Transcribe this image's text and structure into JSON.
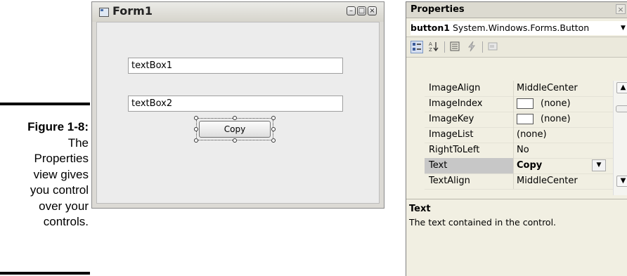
{
  "figure": {
    "number": "Figure 1-8:",
    "lines": [
      "The",
      "Properties",
      "view gives",
      "you control",
      "over your",
      "controls."
    ]
  },
  "form": {
    "title": "Form1",
    "textbox1": "textBox1",
    "textbox2": "textBox2",
    "button_label": "Copy"
  },
  "properties": {
    "title": "Properties",
    "close_glyph": "×",
    "object_name": "button1",
    "object_type": "System.Windows.Forms.Button",
    "toolbar_icons": [
      "categorized-icon",
      "alphabetical-icon",
      "properties-icon",
      "events-icon",
      "property-pages-icon"
    ],
    "rows": [
      {
        "name": "ImageAlign",
        "value": "MiddleCenter"
      },
      {
        "name": "ImageIndex",
        "value": "(none)",
        "swatch": true
      },
      {
        "name": "ImageKey",
        "value": "(none)",
        "swatch": true
      },
      {
        "name": "ImageList",
        "value": "(none)"
      },
      {
        "name": "RightToLeft",
        "value": "No"
      },
      {
        "name": "Text",
        "value": "Copy",
        "selected": true,
        "bold": true,
        "dropdown": true
      },
      {
        "name": "TextAlign",
        "value": "MiddleCenter"
      }
    ],
    "description": {
      "title": "Text",
      "text": "The text contained in the control."
    }
  }
}
